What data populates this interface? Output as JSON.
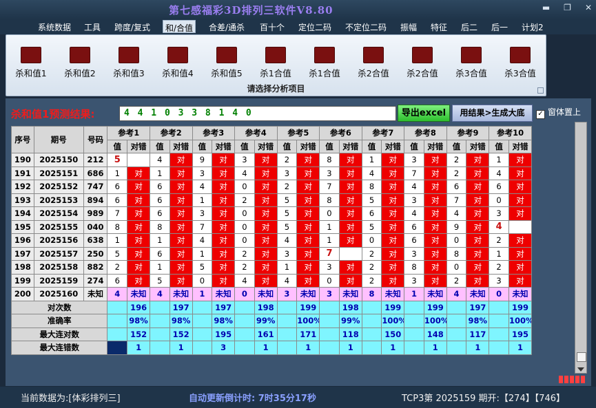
{
  "window": {
    "title": "第七感福彩3D排列三软件V8.80"
  },
  "menu": [
    "系统数据",
    "工具",
    "跨度/复式",
    "和/合值",
    "合差/通杀",
    "百十个",
    "定位二码",
    "不定位二码",
    "振幅",
    "特征",
    "后二",
    "后一",
    "计划2"
  ],
  "ribbon": {
    "buttons": [
      "杀和值1",
      "杀和值2",
      "杀和值3",
      "杀和值4",
      "杀和值5",
      "杀1合值",
      "杀1合值",
      "杀2合值",
      "杀2合值",
      "杀3合值",
      "杀3合值"
    ],
    "caption": "请选择分析项目"
  },
  "prediction": {
    "label": "杀和值1预测结果:",
    "value": "4 4 1 0 3 3 8 1 4 0",
    "export_label": "导出excel",
    "generate_label": "用结果>生成大底",
    "checkbox_label": "窗体置上",
    "checkbox_mark": "✓"
  },
  "table": {
    "col_headers": [
      "序号",
      "期号",
      "号码"
    ],
    "groups": [
      "参考1",
      "参考2",
      "参考3",
      "参考4",
      "参考5",
      "参考6",
      "参考7",
      "参考8",
      "参考9",
      "参考10"
    ],
    "sub_headers": [
      "值",
      "对错"
    ],
    "ok_text": "对",
    "unknown_text": "未知",
    "rows": [
      {
        "seq": "190",
        "period": "2025150",
        "code": "212",
        "vals": [
          "5",
          "4",
          "9",
          "3",
          "2",
          "8",
          "1",
          "3",
          "2",
          "1"
        ],
        "res": [
          "",
          "对",
          "对",
          "对",
          "对",
          "对",
          "对",
          "对",
          "对",
          "对"
        ]
      },
      {
        "seq": "191",
        "period": "2025151",
        "code": "686",
        "vals": [
          "1",
          "1",
          "3",
          "4",
          "3",
          "3",
          "4",
          "7",
          "2",
          "4"
        ],
        "res": [
          "对",
          "对",
          "对",
          "对",
          "对",
          "对",
          "对",
          "对",
          "对",
          "对"
        ]
      },
      {
        "seq": "192",
        "period": "2025152",
        "code": "747",
        "vals": [
          "6",
          "6",
          "4",
          "0",
          "2",
          "7",
          "8",
          "4",
          "6",
          "6"
        ],
        "res": [
          "对",
          "对",
          "对",
          "对",
          "对",
          "对",
          "对",
          "对",
          "对",
          "对"
        ]
      },
      {
        "seq": "193",
        "period": "2025153",
        "code": "894",
        "vals": [
          "6",
          "6",
          "1",
          "2",
          "5",
          "8",
          "5",
          "3",
          "7",
          "0"
        ],
        "res": [
          "对",
          "对",
          "对",
          "对",
          "对",
          "对",
          "对",
          "对",
          "对",
          "对"
        ]
      },
      {
        "seq": "194",
        "period": "2025154",
        "code": "989",
        "vals": [
          "7",
          "6",
          "3",
          "0",
          "5",
          "0",
          "6",
          "4",
          "4",
          "3"
        ],
        "res": [
          "对",
          "对",
          "对",
          "对",
          "对",
          "对",
          "对",
          "对",
          "对",
          "对"
        ]
      },
      {
        "seq": "195",
        "period": "2025155",
        "code": "040",
        "vals": [
          "8",
          "8",
          "7",
          "0",
          "5",
          "1",
          "5",
          "6",
          "9",
          "4"
        ],
        "res": [
          "对",
          "对",
          "对",
          "对",
          "对",
          "对",
          "对",
          "对",
          "对",
          ""
        ]
      },
      {
        "seq": "196",
        "period": "2025156",
        "code": "638",
        "vals": [
          "1",
          "1",
          "4",
          "0",
          "4",
          "1",
          "0",
          "6",
          "0",
          "2"
        ],
        "res": [
          "对",
          "对",
          "对",
          "对",
          "对",
          "对",
          "对",
          "对",
          "对",
          "对"
        ]
      },
      {
        "seq": "197",
        "period": "2025157",
        "code": "250",
        "vals": [
          "5",
          "6",
          "1",
          "2",
          "3",
          "7",
          "2",
          "3",
          "8",
          "1"
        ],
        "res": [
          "对",
          "对",
          "对",
          "对",
          "对",
          "",
          "对",
          "对",
          "对",
          "对"
        ]
      },
      {
        "seq": "198",
        "period": "2025158",
        "code": "882",
        "vals": [
          "2",
          "1",
          "5",
          "2",
          "1",
          "3",
          "2",
          "8",
          "0",
          "2"
        ],
        "res": [
          "对",
          "对",
          "对",
          "对",
          "对",
          "对",
          "对",
          "对",
          "对",
          "对"
        ]
      },
      {
        "seq": "199",
        "period": "2025159",
        "code": "274",
        "vals": [
          "6",
          "5",
          "0",
          "4",
          "4",
          "0",
          "2",
          "3",
          "2",
          "3"
        ],
        "res": [
          "对",
          "对",
          "对",
          "对",
          "对",
          "对",
          "对",
          "对",
          "对",
          "对"
        ]
      }
    ],
    "pending": {
      "seq": "200",
      "period": "2025160",
      "code": "未知",
      "vals": [
        "4",
        "4",
        "1",
        "0",
        "3",
        "3",
        "8",
        "1",
        "4",
        "0"
      ]
    },
    "highlight": [
      {
        "row": 0,
        "col": 0
      },
      {
        "row": 5,
        "col": 9
      },
      {
        "row": 7,
        "col": 5
      }
    ],
    "stats": [
      {
        "label": "对次数",
        "values": [
          "196",
          "197",
          "197",
          "198",
          "199",
          "198",
          "199",
          "199",
          "197",
          "199"
        ]
      },
      {
        "label": "准确率",
        "values": [
          "98%",
          "98%",
          "98%",
          "99%",
          "100%",
          "99%",
          "100%",
          "100%",
          "98%",
          "100%"
        ]
      },
      {
        "label": "最大连对数",
        "values": [
          "152",
          "152",
          "195",
          "161",
          "171",
          "118",
          "150",
          "148",
          "117",
          "195"
        ]
      },
      {
        "label": "最大连错数",
        "values": [
          "1",
          "1",
          "3",
          "1",
          "1",
          "1",
          "1",
          "1",
          "1",
          "1"
        ]
      }
    ]
  },
  "status": {
    "left": "当前数据为:[体彩排列三]",
    "middle": "自动更新倒计时:  7时35分17秒",
    "right": "TCP3第 2025159 期开:【274】【746】"
  }
}
